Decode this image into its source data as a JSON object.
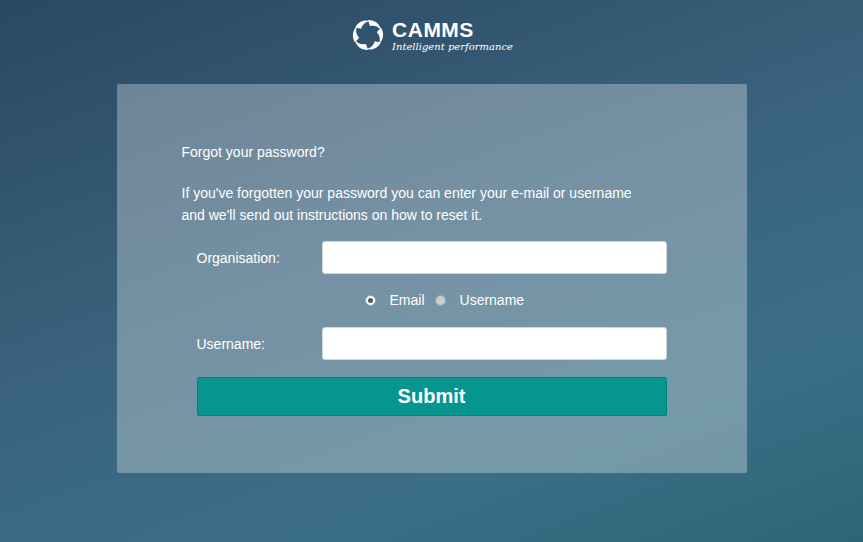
{
  "logo": {
    "name": "CAMMS",
    "tagline": "Intelligent performance"
  },
  "heading": "Forgot your password?",
  "instructions": [
    "If you've forgotten your password you can enter your e-mail or username",
    "and we'll send out instructions on how to reset it."
  ],
  "organisation": {
    "label": "Organisation:",
    "value": ""
  },
  "lookup_by": [
    {
      "label": "Email",
      "selected": true
    },
    {
      "label": "Username",
      "selected": false
    }
  ],
  "username": {
    "label": "Username:",
    "value": ""
  },
  "submit": "Submit"
}
